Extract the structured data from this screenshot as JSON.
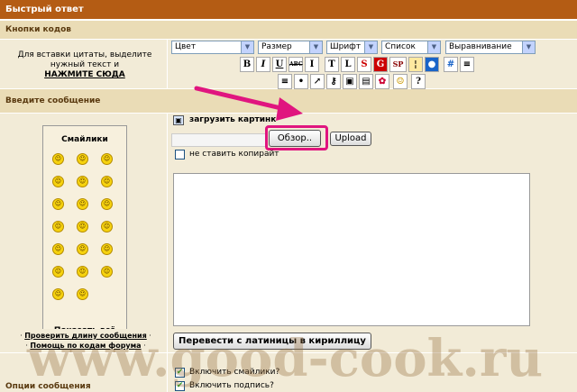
{
  "title": "Быстрый ответ",
  "code_buttons": {
    "heading": "Кнопки кодов",
    "hint": "Для вставки цитаты, выделите нужный текст и",
    "hint_link": "НАЖМИТЕ СЮДА",
    "selects": [
      "Цвет",
      "Размер",
      "Шрифт",
      "Список",
      "Выравнивание"
    ],
    "format_buttons": [
      "B",
      "I",
      "U",
      "ABC",
      "I",
      "T",
      "L",
      "S",
      "G",
      "SP",
      "¦",
      "●",
      "#",
      "≡"
    ],
    "icon_buttons": [
      "list",
      "dot",
      "link",
      "key",
      "image",
      "image2",
      "flower",
      "smile",
      "help"
    ]
  },
  "message": {
    "heading": "Введите сообщение",
    "upload_label": "загрузить картинк",
    "browse_label": "Обзор..",
    "upload_button": "Upload",
    "no_copyright_label": "не ставить копирайт",
    "body": ""
  },
  "smilies": {
    "title": "Смайлики",
    "faces": [
      "☺",
      "☺",
      "☺",
      "☺",
      "☺",
      "☺",
      "☺",
      "☺",
      "☺",
      "☺",
      "☺",
      "☺",
      "☺",
      "☺",
      "☺",
      "☺",
      "☺",
      "☺",
      "☺",
      "☺"
    ],
    "show_all": "Показать всё"
  },
  "links": {
    "check_length": "Проверить длину сообщения",
    "forum_help": "Помощь по кодам форума"
  },
  "translit_button": "Перевести с латиницы в кириллицу",
  "options": {
    "heading": "Опции сообщения",
    "enable_smilies": "Включить смайлики?",
    "enable_signature": "Включить подпись?"
  },
  "watermark": "www.good-cook.ru",
  "colors": {
    "title_bg": "#b45c14",
    "section_bg": "#eadcb6",
    "cell_bg": "#f2ebd7",
    "highlight": "#e0157f"
  }
}
